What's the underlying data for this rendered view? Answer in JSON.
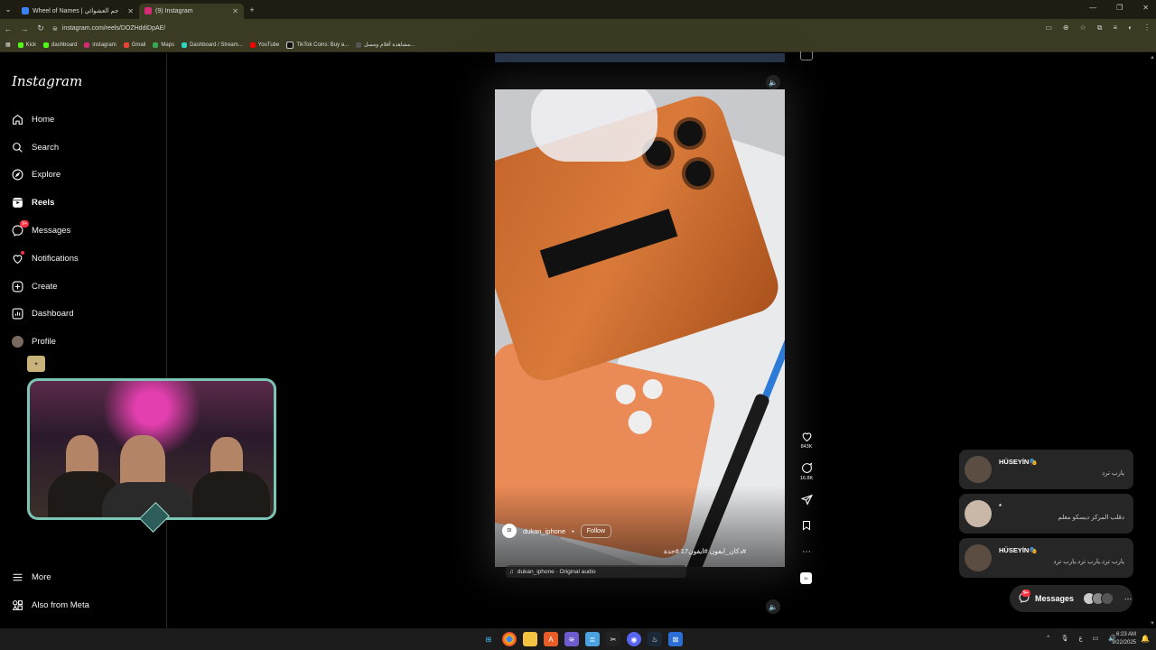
{
  "browser": {
    "tabs": [
      {
        "title": "Wheel of Names | جم العشوائي",
        "color": "#3b82f6"
      },
      {
        "title": "(9) Instagram",
        "color": "#d62976"
      }
    ],
    "new_tab": "+",
    "url": "instagram.com/reels/DOZHddiDpAE/",
    "bookmarks": [
      "Kick",
      "dashboard",
      "instagram",
      "Gmail",
      "Maps",
      "Dashboard / Stream...",
      "YouTube",
      "TikTok Coins: Buy a...",
      "مشاهدة أفلام ومسل..."
    ]
  },
  "sidebar": {
    "logo": "Instagram",
    "items": [
      {
        "label": "Home",
        "icon": "home-icon"
      },
      {
        "label": "Search",
        "icon": "search-icon"
      },
      {
        "label": "Explore",
        "icon": "compass-icon"
      },
      {
        "label": "Reels",
        "icon": "reels-icon"
      },
      {
        "label": "Messages",
        "icon": "messenger-icon",
        "badge": "9+"
      },
      {
        "label": "Notifications",
        "icon": "heart-icon"
      },
      {
        "label": "Create",
        "icon": "plus-square-icon"
      },
      {
        "label": "Dashboard",
        "icon": "chart-icon"
      },
      {
        "label": "Profile",
        "icon": "avatar"
      }
    ],
    "more": "More",
    "meta": "Also from Meta"
  },
  "reel": {
    "username": "dukan_iphone",
    "separator": "•",
    "follow": "Follow",
    "caption": "#دكان_ايفون #ايفون17 #جدة",
    "audio": "dukan_iphone · Original audio",
    "likes": "843K",
    "comments": "16.8K"
  },
  "notifications": [
    {
      "name": "HÜSEYİN🎭",
      "message": "يارب ترد"
    },
    {
      "name": "*",
      "message": "دقلب المركز ديسكو معلم"
    },
    {
      "name": "HÜSEYİN🎭",
      "message": "يارب ترد.يارب ترد.يارب ترد"
    }
  ],
  "messages_pill": {
    "label": "Messages",
    "badge": "9+"
  },
  "taskbar": {
    "lang": "ع",
    "time": "6:23 AM",
    "date": "9/22/2025"
  }
}
